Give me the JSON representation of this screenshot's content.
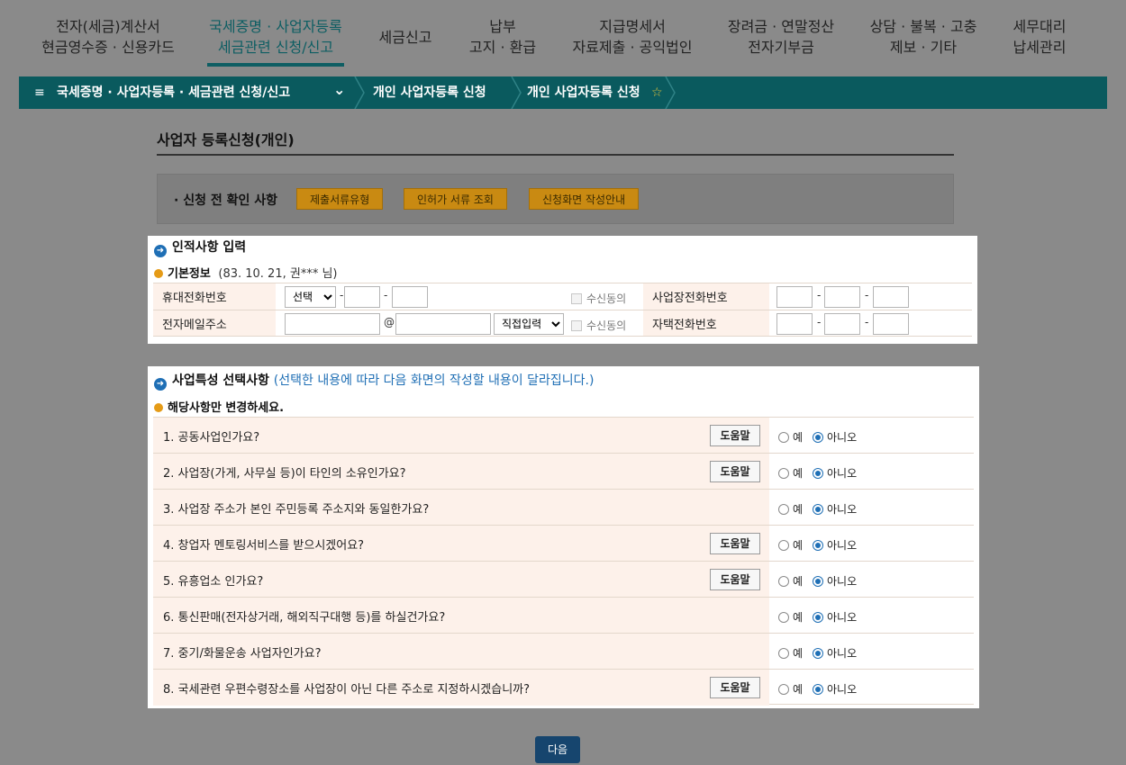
{
  "nav": {
    "items": [
      {
        "line1": "전자(세금)계산서",
        "line2": "현금영수증 · 신용카드"
      },
      {
        "line1": "국세증명 · 사업자등록",
        "line2": "세금관련 신청/신고"
      },
      {
        "line1": "세금신고",
        "line2": ""
      },
      {
        "line1": "납부",
        "line2": "고지 · 환급"
      },
      {
        "line1": "지급명세서",
        "line2": "자료제출 · 공익법인"
      },
      {
        "line1": "장려금 · 연말정산",
        "line2": "전자기부금"
      },
      {
        "line1": "상담 · 불복 · 고충",
        "line2": "제보 · 기타"
      },
      {
        "line1": "세무대리",
        "line2": "납세관리"
      }
    ]
  },
  "breadcrumb": {
    "menu_icon": "≡",
    "level1": "국세증명 · 사업자등록 · 세금관련 신청/신고",
    "level2": "개인 사업자등록 신청",
    "level3": "개인 사업자등록 신청",
    "star_icon": "☆",
    "chevron": "⌄"
  },
  "page": {
    "title": "사업자 등록신청(개인)"
  },
  "precheck": {
    "label": "· 신청 전 확인 사항",
    "buttons": [
      "제출서류유형",
      "인허가 서류 조회",
      "신청화면 작성안내"
    ]
  },
  "personal": {
    "section_title": "인적사항 입력",
    "basic_label": "기본정보",
    "basic_note": "(83. 10. 21, 권*** 님)",
    "mobile_label": "휴대전화번호",
    "mobile_select": "선택",
    "email_label": "전자메일주소",
    "email_at": "@",
    "email_domain_select": "직접입력",
    "consent": "수신동의",
    "biz_phone_label": "사업장전화번호",
    "home_phone_label": "자택전화번호",
    "dash": "-"
  },
  "business": {
    "section_title": "사업특성 선택사항",
    "section_note": "(선택한 내용에 따라 다음 화면의 작성할 내용이 달라집니다.)",
    "sub_title": "해당사항만 변경하세요.",
    "yes": "예",
    "no": "아니오",
    "help": "도움말",
    "questions": [
      {
        "text": "1. 공동사업인가요?",
        "help": true,
        "answer": "no"
      },
      {
        "text": "2. 사업장(가게, 사무실 등)이 타인의 소유인가요?",
        "help": true,
        "answer": "no"
      },
      {
        "text": "3. 사업장 주소가 본인 주민등록 주소지와 동일한가요?",
        "help": false,
        "answer": "no"
      },
      {
        "text": "4. 창업자 멘토링서비스를 받으시겠어요?",
        "help": true,
        "answer": "no"
      },
      {
        "text": "5. 유흥업소 인가요?",
        "help": true,
        "answer": "no"
      },
      {
        "text": "6. 통신판매(전자상거래, 해외직구대행 등)를 하실건가요?",
        "help": false,
        "answer": "no"
      },
      {
        "text": "7. 중기/화물운송 사업자인가요?",
        "help": false,
        "answer": "no"
      },
      {
        "text": "8. 국세관련 우편수령장소를 사업장이 아닌 다른 주소로 지정하시겠습니까?",
        "help": true,
        "answer": "no"
      }
    ]
  },
  "footer": {
    "next_label": "다음"
  }
}
